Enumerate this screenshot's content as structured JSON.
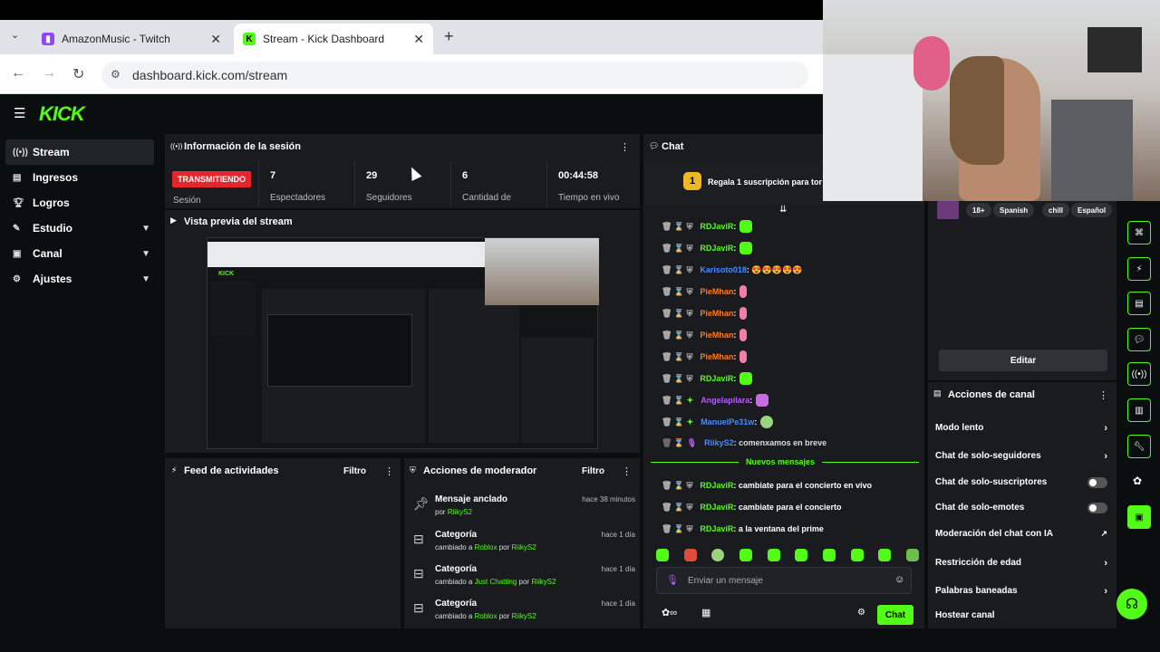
{
  "browser": {
    "tabs": [
      {
        "title": "AmazonMusic - Twitch"
      },
      {
        "title": "Stream - Kick Dashboard"
      }
    ],
    "url": "dashboard.kick.com/stream"
  },
  "app": {
    "logo": "KICK",
    "sidebar": [
      {
        "label": "Stream",
        "icon": "stream-icon"
      },
      {
        "label": "Ingresos",
        "icon": "revenue-icon"
      },
      {
        "label": "Logros",
        "icon": "trophy-icon"
      },
      {
        "label": "Estudio",
        "icon": "studio-icon"
      },
      {
        "label": "Canal",
        "icon": "channel-icon"
      },
      {
        "label": "Ajustes",
        "icon": "gear-icon"
      }
    ],
    "session": {
      "title": "Información de la sesión",
      "status": "TRANSMITIENDO",
      "status_label": "Sesión",
      "stats": [
        {
          "value": "7",
          "label": "Espectadores"
        },
        {
          "value": "29",
          "label": "Seguidores"
        },
        {
          "value": "6",
          "label": "Cantidad de"
        },
        {
          "value": "00:44:58",
          "label": "Tiempo en vivo"
        }
      ]
    },
    "preview": {
      "title": "Vista previa del stream"
    },
    "activity": {
      "title": "Feed de actividades",
      "filter": "Filtro"
    },
    "mod_actions": {
      "title": "Acciones de moderador",
      "filter": "Filtro",
      "items": [
        {
          "title": "Mensaje anclado",
          "sub_prefix": "por",
          "user": "RiikyS2",
          "mid_text": "",
          "target": "",
          "time": "hace 38 minutos"
        },
        {
          "title": "Categoría",
          "sub_prefix": "cambiado a",
          "target": "Roblox",
          "mid_text": "por",
          "user": "RiikyS2",
          "time": "hace 1 día"
        },
        {
          "title": "Categoría",
          "sub_prefix": "cambiado a",
          "target": "Just Chatting",
          "mid_text": "por",
          "user": "RiikyS2",
          "time": "hace 1 día"
        },
        {
          "title": "Categoría",
          "sub_prefix": "cambiado a",
          "target": "Roblox",
          "mid_text": "por",
          "user": "RiikyS2",
          "time": "hace 1 día"
        }
      ]
    },
    "chat": {
      "title": "Chat",
      "pinned": "Regala 1 suscripción para tor",
      "messages": [
        {
          "user": "RDJaviR",
          "text": ":",
          "color": "gn"
        },
        {
          "user": "RDJaviR",
          "text": ":",
          "color": "gn"
        },
        {
          "user": "Karisoto018",
          "text": ": 😍😍😍😍😍",
          "color": "bl"
        },
        {
          "user": "PieMhan",
          "text": ":",
          "color": "or"
        },
        {
          "user": "PieMhan",
          "text": ":",
          "color": "or"
        },
        {
          "user": "PieMhan",
          "text": ":",
          "color": "or"
        },
        {
          "user": "PieMhan",
          "text": ":",
          "color": "or"
        },
        {
          "user": "RDJaviR",
          "text": ":",
          "color": "gn"
        },
        {
          "user": "Angelapilara",
          "text": ":",
          "color": "pu"
        },
        {
          "user": "ManuelPe31w",
          "text": ":",
          "color": "bl"
        },
        {
          "user": "RiikyS2",
          "text": ": comenxamos en breve",
          "color": "bl"
        }
      ],
      "new_messages_label": "Nuevos mensajes",
      "new_messages": [
        {
          "user": "RDJaviR",
          "text": ": cambiate para el concierto en vivo"
        },
        {
          "user": "RDJaviR",
          "text": ": cambiate para el concierto"
        },
        {
          "user": "RDJaviR",
          "text": ": a la ventana del prime"
        }
      ],
      "placeholder": "Enviar un mensaje",
      "send": "Chat"
    },
    "stream_info": {
      "tags": [
        "18+",
        "Spanish",
        "chill",
        "Español"
      ],
      "edit": "Editar"
    },
    "channel_actions": {
      "title": "Acciones de canal",
      "items": [
        {
          "label": "Modo lento",
          "control": "chevron"
        },
        {
          "label": "Chat de solo-seguidores",
          "control": "chevron"
        },
        {
          "label": "Chat de solo-suscriptores",
          "control": "toggle"
        },
        {
          "label": "Chat de solo-emotes",
          "control": "toggle"
        },
        {
          "label": "Moderación del chat con IA",
          "control": "external"
        },
        {
          "label": "Restricción de edad",
          "control": "chevron"
        },
        {
          "label": "Palabras baneadas",
          "control": "chevron"
        },
        {
          "label": "Hostear canal",
          "control": "none"
        }
      ]
    }
  },
  "colors": {
    "accent": "#53fc18",
    "live": "#e5262c",
    "panel": "#191b1f",
    "bg": "#0b0e0f"
  }
}
